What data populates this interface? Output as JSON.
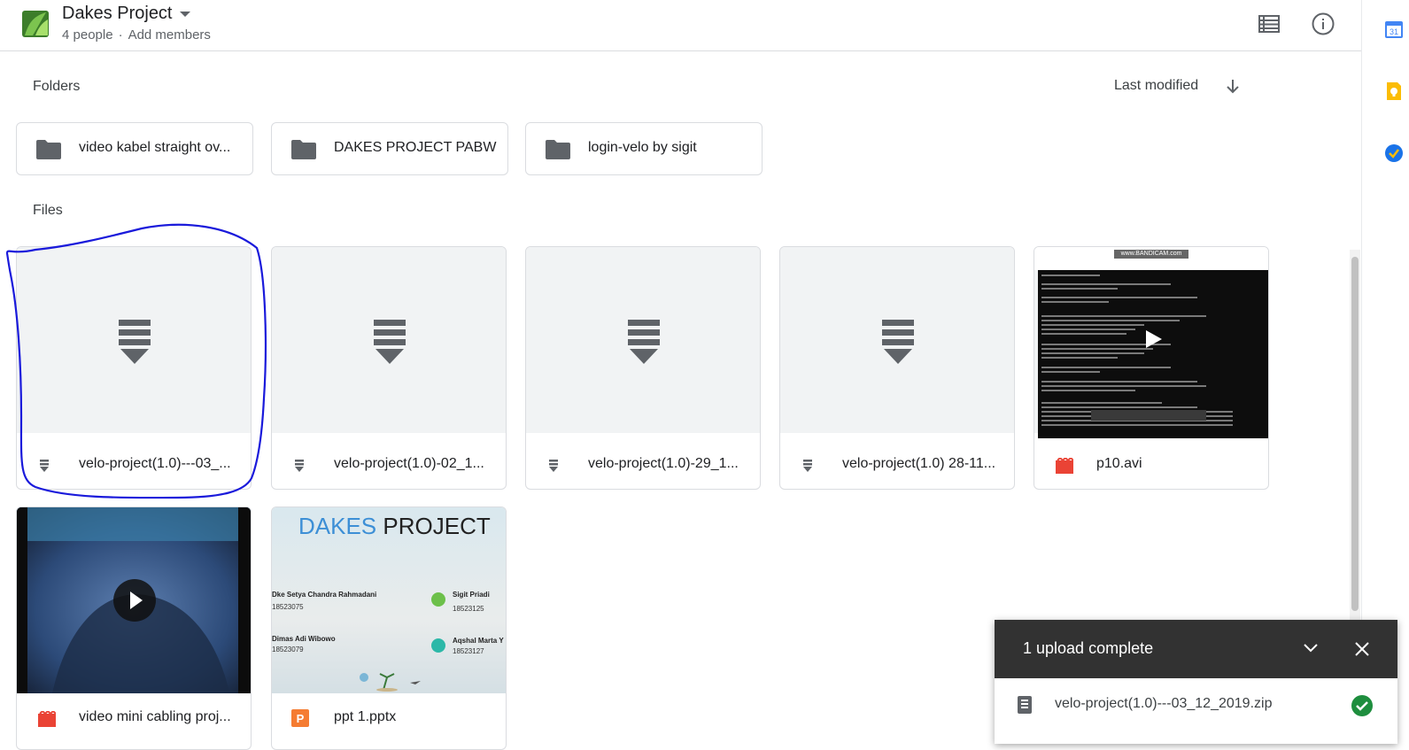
{
  "header": {
    "title": "Dakes Project",
    "people": "4 people",
    "separator": "·",
    "add_members": "Add members"
  },
  "folders_section": {
    "label": "Folders",
    "sort_label": "Last modified",
    "items": [
      {
        "name": "video kabel straight ov..."
      },
      {
        "name": "DAKES PROJECT PABW"
      },
      {
        "name": "login-velo by sigit"
      }
    ]
  },
  "files_section": {
    "label": "Files",
    "items": [
      {
        "name": "velo-project(1.0)---03_...",
        "icon": "zip-icon"
      },
      {
        "name": "velo-project(1.0)-02_1...",
        "icon": "zip-icon"
      },
      {
        "name": "velo-project(1.0)-29_1...",
        "icon": "zip-icon"
      },
      {
        "name": "velo-project(1.0) 28-11...",
        "icon": "zip-icon"
      },
      {
        "name": "p10.avi",
        "icon": "video-icon"
      },
      {
        "name": "video mini cabling proj...",
        "icon": "video-icon"
      },
      {
        "name": "ppt 1.pptx",
        "icon": "slides-icon"
      }
    ]
  },
  "thumbnails": {
    "p10_banner": "www.BANDICAM.com",
    "ppt": {
      "title_blue": "DAKES",
      "title_dark": "PROJECT",
      "members": [
        {
          "name": "Dke Setya Chandra Rahmadani",
          "id": "18523075"
        },
        {
          "name": "Sigit Priadi",
          "id": "18523125"
        },
        {
          "name": "Dimas Adi Wibowo",
          "id": "18523079"
        },
        {
          "name": "Aqshal Marta Y",
          "id": "18523127"
        }
      ]
    }
  },
  "toast": {
    "title": "1 upload complete",
    "file": "velo-project(1.0)---03_12_2019.zip",
    "status_icon": "check-circle-icon"
  },
  "colors": {
    "toast_header": "#323232",
    "success": "#1e8e3e",
    "annotation": "#1a1adb",
    "video_red": "#ea4335",
    "slides_orange": "#f57c32"
  }
}
